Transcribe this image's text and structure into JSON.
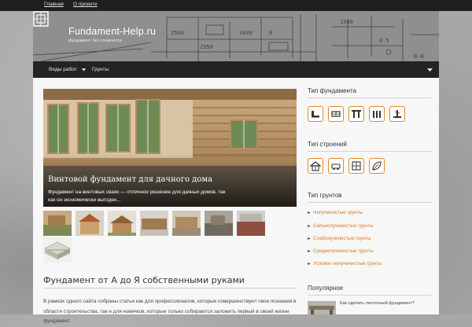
{
  "topbar": {
    "links": [
      {
        "label": "Главная"
      },
      {
        "label": "О проекте"
      }
    ]
  },
  "header": {
    "title": "Fundament-Help.ru",
    "tagline": "фундамент без сложности"
  },
  "nav": {
    "items": [
      {
        "label": "Виды работ"
      },
      {
        "label": "Грунты"
      }
    ]
  },
  "slider": {
    "title": "Винтовой фундамент для дачного дома",
    "text": "Фундамент на винтовых сваях — отличное решение для дачных домов, так как он экономически выгоден..."
  },
  "article": {
    "title": "Фундамент от А до Я собственными руками",
    "text": "В рамках одного сайта собраны статьи как для профессионалов, которые совершенствуют свои познания в области строительства, так и для новичков, которые только собираются заложить первый в своей жизни фундамент."
  },
  "sidebar": {
    "foundation_type_title": "Тип фундамента",
    "building_type_title": "Тип строений",
    "soil_type_title": "Тип грунтов",
    "soil_items": [
      {
        "label": "Непучинистые грунты"
      },
      {
        "label": "Сильнопучинистые грунты"
      },
      {
        "label": "Слабопучинистые грунты"
      },
      {
        "label": "Среднепучинистые грунты"
      },
      {
        "label": "Условно непучинистые грунты"
      }
    ],
    "popular_title": "Популярное",
    "popular_items": [
      {
        "label": "Как сделать ленточный фундамент?"
      }
    ]
  },
  "colors": {
    "accent": "#e08a2b",
    "link": "#d97a1f",
    "topbar": "#1e1e1e",
    "nav": "#232323"
  }
}
